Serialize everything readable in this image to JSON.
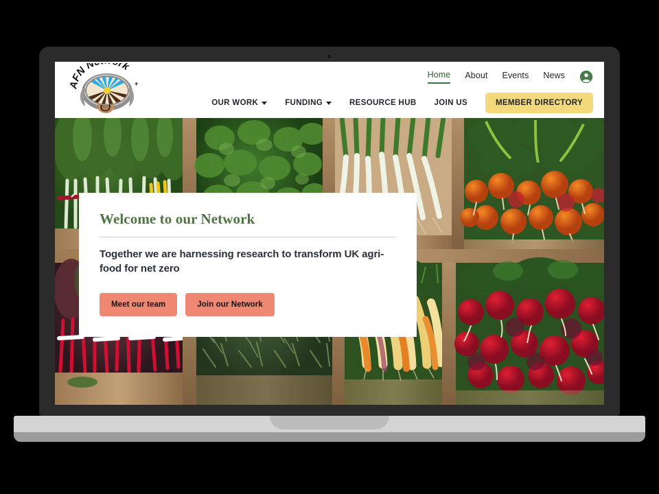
{
  "device": {
    "type": "laptop-mockup",
    "frame_color": "#2b2b2b",
    "base_color": "#d4d4d4",
    "backdrop_color": "#000000"
  },
  "site": {
    "logo": {
      "name": "afn-network-plus-logo",
      "text_top": "AFN Network",
      "text_plus": "+",
      "emblem_description": "circular emblem with blue sky rays, yellow sun, brown ploughed soil furrows and a handshake",
      "colors": {
        "sky": "#29ABE2",
        "sun": "#F2D02C",
        "soil": "#5A3A21",
        "cream": "#F2E3CC",
        "grey": "#9A9A9A",
        "hand": "#C08A5A"
      }
    },
    "nav_top": [
      {
        "label": "Home",
        "active": true
      },
      {
        "label": "About",
        "active": false
      },
      {
        "label": "Events",
        "active": false
      },
      {
        "label": "News",
        "active": false
      }
    ],
    "account_icon": "account-circle-icon",
    "nav_main": [
      {
        "label": "OUR WORK",
        "has_dropdown": true
      },
      {
        "label": "FUNDING",
        "has_dropdown": true
      },
      {
        "label": "RESOURCE HUB",
        "has_dropdown": false
      },
      {
        "label": "JOIN US",
        "has_dropdown": false
      }
    ],
    "member_directory_button": "MEMBER DIRECTORY",
    "accent_colors": {
      "active_nav_green": "#3d7340",
      "heading_green": "#4e7344",
      "button_yellow": "#f2d97c",
      "button_salmon": "#ee8873"
    }
  },
  "hero": {
    "background_description": "overhead photo of a farm market stall: wooden crates of rainbow chard, herbs, spring onions, golden beets, purple beetroot, orange and rainbow carrots, and red radishes",
    "card": {
      "title": "Welcome to our Network",
      "subtitle": "Together we are harnessing research to transform UK agri-food for net zero",
      "buttons": [
        {
          "label": "Meet our team"
        },
        {
          "label": "Join our Network"
        }
      ]
    }
  }
}
